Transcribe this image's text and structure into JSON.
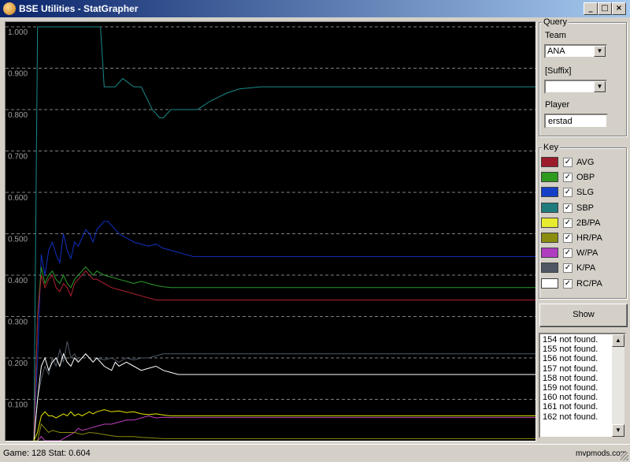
{
  "window": {
    "title": "BSE Utilities - StatGrapher",
    "controls": [
      "_",
      "□",
      "×"
    ]
  },
  "chart_data": {
    "type": "line",
    "title": "",
    "xlabel": "",
    "ylabel": "",
    "ylim": [
      0,
      1.0
    ],
    "xlim": [
      1,
      128
    ],
    "y_ticks": [
      "1.000",
      "0.900",
      "0.800",
      "0.700",
      "0.600",
      "0.500",
      "0.400",
      "0.300",
      "0.200",
      "0.100"
    ],
    "grid": true,
    "grid_style": "dashed",
    "series": [
      {
        "name": "SBP",
        "color": "#1a8a8a",
        "points": [
          [
            1,
            0
          ],
          [
            2,
            1.0
          ],
          [
            10,
            1.0
          ],
          [
            15,
            1.0
          ],
          [
            19,
            1.0
          ],
          [
            20,
            0.855
          ],
          [
            23,
            0.855
          ],
          [
            25,
            0.875
          ],
          [
            28,
            0.855
          ],
          [
            30,
            0.855
          ],
          [
            33,
            0.8
          ],
          [
            35,
            0.78
          ],
          [
            36,
            0.78
          ],
          [
            38,
            0.8
          ],
          [
            40,
            0.8
          ],
          [
            42,
            0.8
          ],
          [
            45,
            0.8
          ],
          [
            48,
            0.82
          ],
          [
            50,
            0.83
          ],
          [
            52,
            0.84
          ],
          [
            55,
            0.85
          ],
          [
            60,
            0.855
          ],
          [
            128,
            0.855
          ]
        ]
      },
      {
        "name": "SLG",
        "color": "#1030c0",
        "points": [
          [
            1,
            0
          ],
          [
            2,
            0.2
          ],
          [
            3,
            0.45
          ],
          [
            4,
            0.4
          ],
          [
            5,
            0.46
          ],
          [
            6,
            0.48
          ],
          [
            7,
            0.45
          ],
          [
            8,
            0.43
          ],
          [
            9,
            0.5
          ],
          [
            10,
            0.46
          ],
          [
            11,
            0.44
          ],
          [
            12,
            0.48
          ],
          [
            13,
            0.47
          ],
          [
            14,
            0.49
          ],
          [
            15,
            0.51
          ],
          [
            16,
            0.5
          ],
          [
            17,
            0.48
          ],
          [
            18,
            0.51
          ],
          [
            19,
            0.52
          ],
          [
            20,
            0.53
          ],
          [
            21,
            0.53
          ],
          [
            22,
            0.52
          ],
          [
            23,
            0.51
          ],
          [
            24,
            0.5
          ],
          [
            26,
            0.49
          ],
          [
            28,
            0.48
          ],
          [
            30,
            0.475
          ],
          [
            32,
            0.47
          ],
          [
            34,
            0.475
          ],
          [
            36,
            0.465
          ],
          [
            38,
            0.46
          ],
          [
            40,
            0.455
          ],
          [
            42,
            0.45
          ],
          [
            44,
            0.445
          ],
          [
            128,
            0.445
          ]
        ]
      },
      {
        "name": "OBP",
        "color": "#2a9a2a",
        "points": [
          [
            1,
            0
          ],
          [
            2,
            0.3
          ],
          [
            3,
            0.42
          ],
          [
            4,
            0.38
          ],
          [
            5,
            0.4
          ],
          [
            6,
            0.41
          ],
          [
            7,
            0.39
          ],
          [
            8,
            0.38
          ],
          [
            9,
            0.4
          ],
          [
            10,
            0.38
          ],
          [
            11,
            0.37
          ],
          [
            12,
            0.39
          ],
          [
            13,
            0.4
          ],
          [
            14,
            0.41
          ],
          [
            15,
            0.42
          ],
          [
            16,
            0.41
          ],
          [
            17,
            0.4
          ],
          [
            18,
            0.41
          ],
          [
            20,
            0.4
          ],
          [
            22,
            0.395
          ],
          [
            24,
            0.39
          ],
          [
            26,
            0.385
          ],
          [
            28,
            0.38
          ],
          [
            30,
            0.385
          ],
          [
            32,
            0.38
          ],
          [
            34,
            0.375
          ],
          [
            36,
            0.372
          ],
          [
            38,
            0.37
          ],
          [
            40,
            0.37
          ],
          [
            128,
            0.37
          ]
        ]
      },
      {
        "name": "AVG",
        "color": "#b02030",
        "points": [
          [
            1,
            0
          ],
          [
            2,
            0.3
          ],
          [
            3,
            0.4
          ],
          [
            4,
            0.37
          ],
          [
            5,
            0.39
          ],
          [
            6,
            0.4
          ],
          [
            7,
            0.37
          ],
          [
            8,
            0.36
          ],
          [
            9,
            0.38
          ],
          [
            10,
            0.37
          ],
          [
            11,
            0.35
          ],
          [
            12,
            0.38
          ],
          [
            13,
            0.39
          ],
          [
            14,
            0.4
          ],
          [
            15,
            0.41
          ],
          [
            16,
            0.4
          ],
          [
            17,
            0.39
          ],
          [
            18,
            0.39
          ],
          [
            20,
            0.38
          ],
          [
            22,
            0.37
          ],
          [
            24,
            0.365
          ],
          [
            26,
            0.36
          ],
          [
            28,
            0.355
          ],
          [
            30,
            0.35
          ],
          [
            32,
            0.345
          ],
          [
            34,
            0.34
          ],
          [
            36,
            0.34
          ],
          [
            38,
            0.34
          ],
          [
            40,
            0.34
          ],
          [
            128,
            0.34
          ]
        ]
      },
      {
        "name": "K/PA",
        "color": "#505a68",
        "points": [
          [
            1,
            0
          ],
          [
            2,
            0.1
          ],
          [
            3,
            0.15
          ],
          [
            4,
            0.18
          ],
          [
            5,
            0.16
          ],
          [
            6,
            0.2
          ],
          [
            7,
            0.18
          ],
          [
            8,
            0.22
          ],
          [
            9,
            0.19
          ],
          [
            10,
            0.24
          ],
          [
            11,
            0.2
          ],
          [
            12,
            0.21
          ],
          [
            13,
            0.19
          ],
          [
            14,
            0.2
          ],
          [
            15,
            0.21
          ],
          [
            16,
            0.2
          ],
          [
            17,
            0.19
          ],
          [
            18,
            0.2
          ],
          [
            20,
            0.195
          ],
          [
            22,
            0.2
          ],
          [
            24,
            0.19
          ],
          [
            26,
            0.2
          ],
          [
            28,
            0.195
          ],
          [
            30,
            0.2
          ],
          [
            32,
            0.2
          ],
          [
            34,
            0.205
          ],
          [
            36,
            0.21
          ],
          [
            38,
            0.21
          ],
          [
            128,
            0.21
          ]
        ]
      },
      {
        "name": "RC/PA",
        "color": "#ffffff",
        "points": [
          [
            1,
            0
          ],
          [
            2,
            0.1
          ],
          [
            3,
            0.18
          ],
          [
            4,
            0.2
          ],
          [
            5,
            0.17
          ],
          [
            6,
            0.19
          ],
          [
            7,
            0.2
          ],
          [
            8,
            0.18
          ],
          [
            9,
            0.21
          ],
          [
            10,
            0.19
          ],
          [
            11,
            0.18
          ],
          [
            12,
            0.2
          ],
          [
            13,
            0.19
          ],
          [
            14,
            0.2
          ],
          [
            15,
            0.21
          ],
          [
            16,
            0.2
          ],
          [
            17,
            0.19
          ],
          [
            18,
            0.2
          ],
          [
            20,
            0.18
          ],
          [
            22,
            0.17
          ],
          [
            23,
            0.19
          ],
          [
            24,
            0.18
          ],
          [
            26,
            0.19
          ],
          [
            28,
            0.18
          ],
          [
            30,
            0.17
          ],
          [
            32,
            0.175
          ],
          [
            34,
            0.18
          ],
          [
            36,
            0.17
          ],
          [
            38,
            0.165
          ],
          [
            40,
            0.16
          ],
          [
            128,
            0.16
          ]
        ]
      },
      {
        "name": "2B/PA",
        "color": "#e6e600",
        "points": [
          [
            1,
            0
          ],
          [
            2,
            0.02
          ],
          [
            3,
            0.06
          ],
          [
            4,
            0.07
          ],
          [
            5,
            0.06
          ],
          [
            6,
            0.06
          ],
          [
            7,
            0.055
          ],
          [
            8,
            0.06
          ],
          [
            9,
            0.065
          ],
          [
            10,
            0.06
          ],
          [
            11,
            0.07
          ],
          [
            12,
            0.06
          ],
          [
            13,
            0.065
          ],
          [
            14,
            0.06
          ],
          [
            15,
            0.065
          ],
          [
            16,
            0.07
          ],
          [
            17,
            0.065
          ],
          [
            18,
            0.07
          ],
          [
            20,
            0.075
          ],
          [
            22,
            0.07
          ],
          [
            24,
            0.072
          ],
          [
            26,
            0.068
          ],
          [
            28,
            0.07
          ],
          [
            30,
            0.065
          ],
          [
            32,
            0.063
          ],
          [
            34,
            0.065
          ],
          [
            36,
            0.062
          ],
          [
            38,
            0.06
          ],
          [
            128,
            0.06
          ]
        ]
      },
      {
        "name": "W/PA",
        "color": "#c040c0",
        "points": [
          [
            1,
            0
          ],
          [
            2,
            0.0
          ],
          [
            3,
            0.01
          ],
          [
            4,
            0.0
          ],
          [
            6,
            0.0
          ],
          [
            8,
            0.0
          ],
          [
            10,
            0.01
          ],
          [
            12,
            0.02
          ],
          [
            13,
            0.03
          ],
          [
            14,
            0.025
          ],
          [
            16,
            0.03
          ],
          [
            18,
            0.035
          ],
          [
            20,
            0.04
          ],
          [
            22,
            0.04
          ],
          [
            24,
            0.045
          ],
          [
            26,
            0.05
          ],
          [
            28,
            0.05
          ],
          [
            30,
            0.055
          ],
          [
            32,
            0.06
          ],
          [
            34,
            0.055
          ],
          [
            36,
            0.057
          ],
          [
            38,
            0.056
          ],
          [
            40,
            0.056
          ],
          [
            128,
            0.056
          ]
        ]
      },
      {
        "name": "HR/PA",
        "color": "#8a8a10",
        "points": [
          [
            1,
            0
          ],
          [
            2,
            0.0
          ],
          [
            3,
            0.04
          ],
          [
            4,
            0.03
          ],
          [
            5,
            0.02
          ],
          [
            6,
            0.025
          ],
          [
            8,
            0.02
          ],
          [
            10,
            0.02
          ],
          [
            12,
            0.02
          ],
          [
            14,
            0.015
          ],
          [
            16,
            0.02
          ],
          [
            18,
            0.018
          ],
          [
            20,
            0.015
          ],
          [
            22,
            0.012
          ],
          [
            24,
            0.01
          ],
          [
            26,
            0.01
          ],
          [
            28,
            0.01
          ],
          [
            30,
            0.008
          ],
          [
            32,
            0.007
          ],
          [
            34,
            0.006
          ],
          [
            36,
            0.005
          ],
          [
            38,
            0.005
          ],
          [
            128,
            0.005
          ]
        ]
      }
    ]
  },
  "query": {
    "group_title": "Query",
    "team_label": "Team",
    "team_value": "ANA",
    "suffix_label": "[Suffix]",
    "suffix_value": "",
    "player_label": "Player",
    "player_value": "erstad"
  },
  "key": {
    "group_title": "Key",
    "items": [
      {
        "label": "AVG",
        "color": "#9c1c2c",
        "checked": "✓"
      },
      {
        "label": "OBP",
        "color": "#2e9a1e",
        "checked": "✓"
      },
      {
        "label": "SLG",
        "color": "#1440c8",
        "checked": "✓"
      },
      {
        "label": "SBP",
        "color": "#207c7c",
        "checked": "✓"
      },
      {
        "label": "2B/PA",
        "color": "#e8ec30",
        "checked": "✓"
      },
      {
        "label": "HR/PA",
        "color": "#8a8c10",
        "checked": "✓"
      },
      {
        "label": "W/PA",
        "color": "#b03cc0",
        "checked": "✓"
      },
      {
        "label": "K/PA",
        "color": "#505866",
        "checked": "✓"
      },
      {
        "label": "RC/PA",
        "color": "#ffffff",
        "checked": "✓"
      }
    ]
  },
  "show_button": "Show",
  "log": [
    "154 not found.",
    "155 not found.",
    "156 not found.",
    "157 not found.",
    "158 not found.",
    "159 not found.",
    "160 not found.",
    "161 not found.",
    "162 not found."
  ],
  "status": {
    "text": "Game: 128  Stat: 0.604",
    "watermark": "mvpmods.com"
  }
}
